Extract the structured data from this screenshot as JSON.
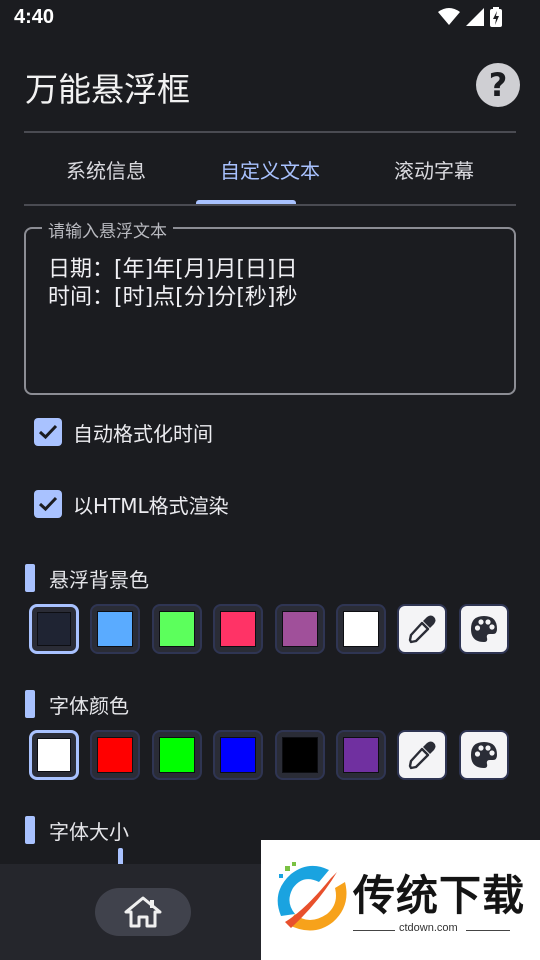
{
  "status_bar": {
    "time": "4:40"
  },
  "header": {
    "title": "万能悬浮框",
    "help_symbol": "?"
  },
  "tabs": [
    {
      "label": "系统信息",
      "active": false
    },
    {
      "label": "自定义文本",
      "active": true
    },
    {
      "label": "滚动字幕",
      "active": false
    }
  ],
  "text_field": {
    "label": "请输入悬浮文本",
    "value": "日期：[年]年[月]月[日]日\n时间：[时]点[分]分[秒]秒"
  },
  "options": [
    {
      "label": "自动格式化时间",
      "checked": true
    },
    {
      "label": "以HTML格式渲染",
      "checked": true
    }
  ],
  "background_color": {
    "title": "悬浮背景色",
    "swatches": [
      "#1f2433",
      "#5aabff",
      "#5cff5c",
      "#ff3366",
      "#a0509a",
      "#ffffff"
    ],
    "selected_index": 0,
    "tools": [
      "eyedropper-icon",
      "palette-icon"
    ]
  },
  "font_color": {
    "title": "字体颜色",
    "swatches": [
      "#ffffff",
      "#ff0000",
      "#00ff00",
      "#0000ff",
      "#000000",
      "#7030a0"
    ],
    "selected_index": 0,
    "tools": [
      "eyedropper-icon",
      "palette-icon"
    ]
  },
  "font_size": {
    "title": "字体大小"
  },
  "bottom_nav": {
    "home_icon": "home-icon"
  },
  "watermark": {
    "text": "传统下载",
    "url": "ctdown.com"
  },
  "colors": {
    "accent": "#a9c2ff",
    "background": "#1b1c20"
  }
}
